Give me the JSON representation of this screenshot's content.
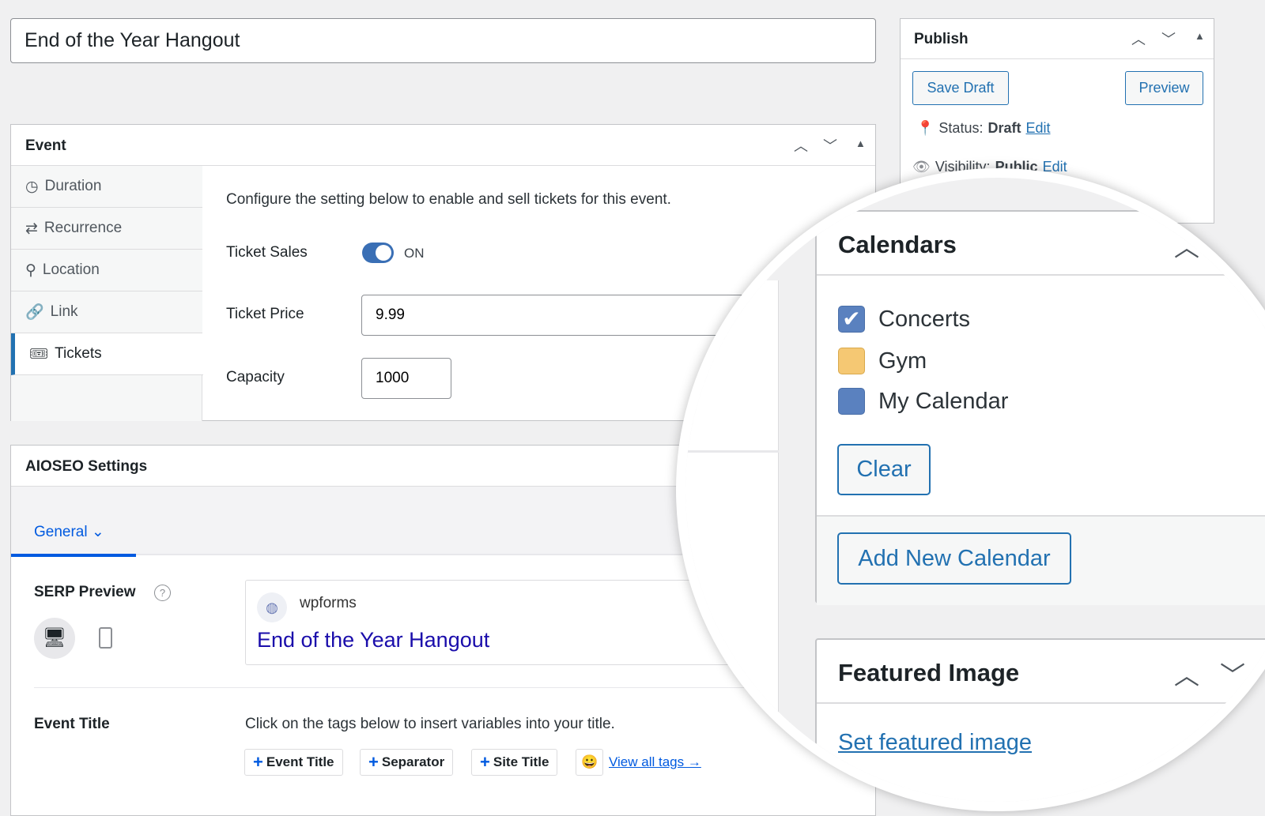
{
  "title_input": {
    "value": "End of the Year Hangout"
  },
  "publish": {
    "title": "Publish",
    "save_draft": "Save Draft",
    "preview": "Preview",
    "status_label": "Status:",
    "status_value": "Draft",
    "status_edit": "Edit",
    "visibility_label": "Visibility:",
    "visibility_value": "Public",
    "visibility_edit": "Edit"
  },
  "event": {
    "title": "Event",
    "nav": [
      {
        "label": "Duration",
        "icon": "clock-icon"
      },
      {
        "label": "Recurrence",
        "icon": "repeat-icon"
      },
      {
        "label": "Location",
        "icon": "location-pin-icon"
      },
      {
        "label": "Link",
        "icon": "link-icon"
      },
      {
        "label": "Tickets",
        "icon": "tickets-icon",
        "active": true
      }
    ],
    "intro": "Configure the setting below to enable and sell tickets for this event.",
    "ticket_sales_label": "Ticket Sales",
    "ticket_sales_state": "ON",
    "ticket_price_label": "Ticket Price",
    "ticket_price_value": "9.99",
    "capacity_label": "Capacity",
    "capacity_value": "1000"
  },
  "aioseo": {
    "title": "AIOSEO Settings",
    "tab": "General",
    "serp_label": "SERP Preview",
    "site_name": "wpforms",
    "serp_title": "End of the Year Hangout",
    "event_title_label": "Event Title",
    "event_title_help": "Click on the tags below to insert variables into your title.",
    "tags": [
      "Event Title",
      "Separator",
      "Site Title"
    ],
    "view_all": "View all tags →"
  },
  "calendars": {
    "title": "Calendars",
    "items": [
      {
        "label": "Concerts",
        "checked": true,
        "color": "#5a81bf"
      },
      {
        "label": "Gym",
        "checked": false,
        "color": "#f5c873"
      },
      {
        "label": "My Calendar",
        "checked": false,
        "color": "#5a81bf"
      }
    ],
    "clear": "Clear",
    "add_new": "Add New Calendar"
  },
  "featured": {
    "title": "Featured Image",
    "link": "Set featured image"
  },
  "colors": {
    "accent": "#2271b1",
    "toggle": "#3a6fb5"
  }
}
